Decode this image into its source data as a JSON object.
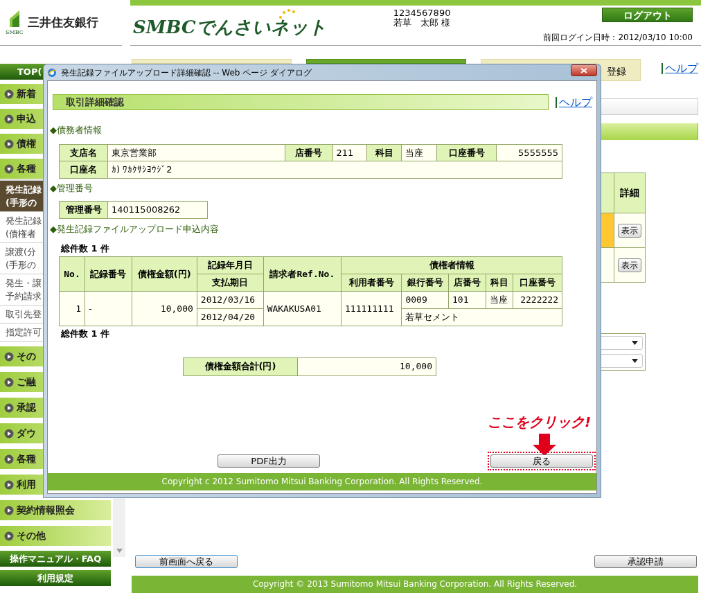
{
  "header": {
    "bank_name": "三井住友銀行",
    "logo_caption": "SMBC",
    "service_name": "SMBCでんさいネット",
    "user_id": "1234567890",
    "user_name": "若草　太郎 様",
    "logout_button": "ログアウト",
    "last_login": "前回ログイン日時：2012/03/10 10:00"
  },
  "sidebar": {
    "items": [
      {
        "kind": "top",
        "label": "TOP("
      },
      {
        "kind": "menu",
        "label": "新着",
        "expanded": false
      },
      {
        "kind": "menu",
        "label": "申込",
        "expanded": false
      },
      {
        "kind": "menu",
        "label": "債権",
        "expanded": false
      },
      {
        "kind": "menu",
        "label": "各種",
        "expanded": true
      },
      {
        "kind": "sub",
        "lines": [
          "発生記録",
          "(手形の"
        ],
        "selected": true
      },
      {
        "kind": "sub",
        "lines": [
          "発生記録",
          "(債権者"
        ],
        "selected": false
      },
      {
        "kind": "sub",
        "lines": [
          "譲渡(分",
          "(手形の"
        ],
        "selected": false
      },
      {
        "kind": "sub",
        "lines": [
          "発生・譲",
          "予約請求"
        ],
        "selected": false
      },
      {
        "kind": "sub",
        "lines": [
          "取引先登"
        ],
        "selected": false
      },
      {
        "kind": "sub",
        "lines": [
          "指定許可"
        ],
        "selected": false
      },
      {
        "kind": "menu",
        "label": "その",
        "expanded": false
      },
      {
        "kind": "menu",
        "label": "ご融",
        "expanded": false
      },
      {
        "kind": "menu",
        "label": "承認",
        "expanded": false
      },
      {
        "kind": "menu",
        "label": "ダウ",
        "expanded": false
      },
      {
        "kind": "menu",
        "label": "各種",
        "expanded": false
      },
      {
        "kind": "menu",
        "label": "利用",
        "expanded": false
      },
      {
        "kind": "menu",
        "label": "契約情報照会",
        "expanded": false
      },
      {
        "kind": "menu",
        "label": "その他",
        "expanded": false
      },
      {
        "kind": "footer",
        "label": "操作マニュアル・FAQ"
      },
      {
        "kind": "footer",
        "label": "利用規定"
      }
    ]
  },
  "main": {
    "tabs": [
      {
        "selected": false
      },
      {
        "selected": true
      },
      {
        "selected": false,
        "label": "登録"
      }
    ],
    "help_link": "ヘルプ",
    "partial_table": {
      "columns": [
        "詳細"
      ],
      "rows": [
        {
          "highlighted": true,
          "button": "表示"
        },
        {
          "highlighted": false,
          "button": "表示"
        }
      ]
    },
    "back_button": "前画面へ戻る",
    "approve_button": "承認申請",
    "footer": "Copyright © 2013 Sumitomo Mitsui Banking Corporation. All Rights Reserved."
  },
  "dialog": {
    "title": "発生記録ファイルアップロード詳細確認 -- Web ページ ダイアログ",
    "heading": "取引詳細確認",
    "help_link": "ヘルプ",
    "debtor": {
      "title": "◆債務者情報",
      "row1": [
        {
          "label": "支店名",
          "value": "東京営業部"
        },
        {
          "label": "店番号",
          "value": "211"
        },
        {
          "label": "科目",
          "value": "当座"
        },
        {
          "label": "口座番号",
          "value": "5555555"
        }
      ],
      "row2": {
        "label": "口座名",
        "value": "ｶ) ﾜｶｸｻｼﾖｳｼﾞ2"
      }
    },
    "management": {
      "title": "◆管理番号",
      "label": "管理番号",
      "value": "140115008262"
    },
    "upload": {
      "title": "◆発生記録ファイルアップロード申込内容",
      "count_top": "総件数 1 件",
      "count_bottom": "総件数 1 件",
      "headers": {
        "no": "No.",
        "record_no": "記録番号",
        "amount": "債権金額(円)",
        "record_date": "記録年月日",
        "due_date": "支払期日",
        "ref": "請求者Ref.No.",
        "creditor": "債権者情報",
        "creditor_cols": [
          "利用者番号",
          "銀行番号",
          "店番号",
          "科目",
          "口座番号"
        ]
      },
      "rows": [
        {
          "no": "1",
          "record_no": "-",
          "amount": "10,000",
          "record_date": "2012/03/16",
          "due_date": "2012/04/20",
          "ref": "WAKAKUSA01",
          "user_no": "111111111",
          "bank_no": "0009",
          "branch_no": "101",
          "subject": "当座",
          "account_no": "2222222",
          "creditor_name": "若草セメント"
        }
      ],
      "total_label": "債権金額合計(円)",
      "total_value": "10,000"
    },
    "pdf_button": "PDF出力",
    "back_button": "戻る",
    "annotation": "ここをクリック!",
    "footer": "Copyright c 2012 Sumitomo Mitsui Banking Corporation. All Rights Reserved."
  }
}
